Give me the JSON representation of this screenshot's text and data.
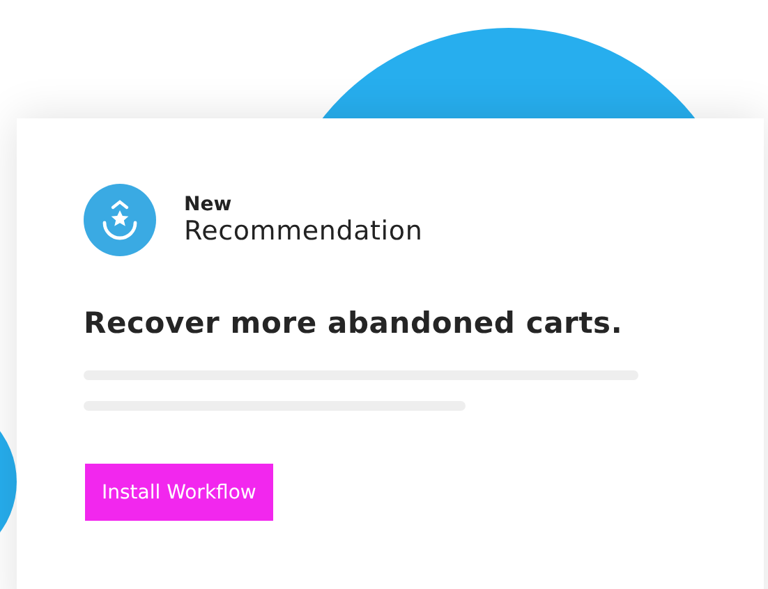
{
  "card": {
    "badge": "New",
    "title": "Recommendation",
    "headline": "Recover more abandoned carts.",
    "button": "Install Workflow"
  }
}
